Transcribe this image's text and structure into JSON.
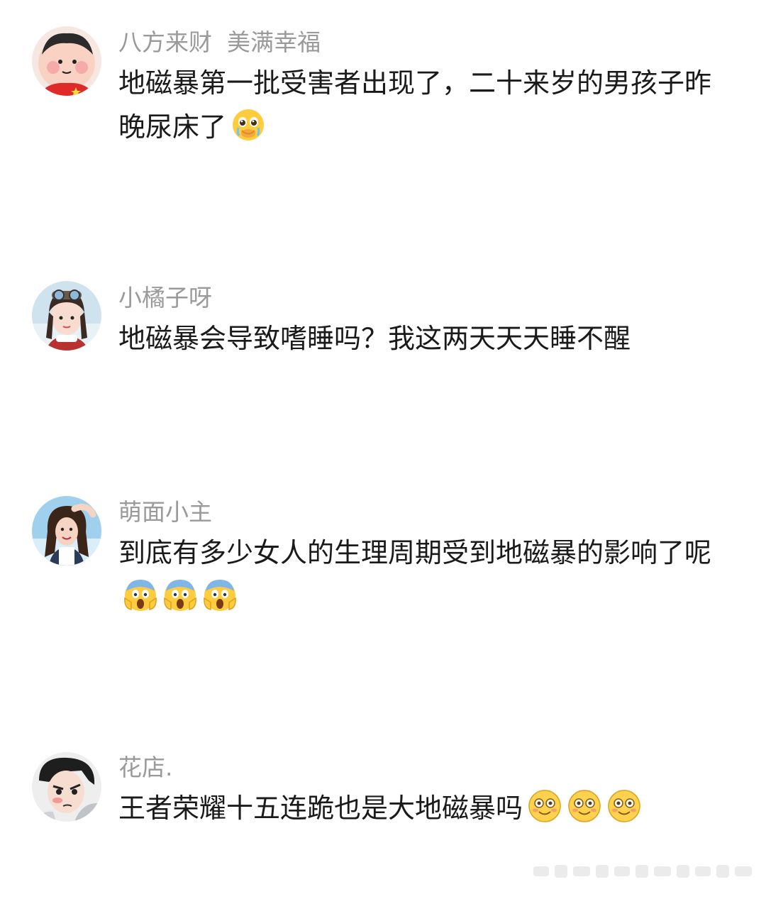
{
  "comments": [
    {
      "username": "八方来财  美满幸福",
      "text": "地磁暴第一批受害者出现了，二十来岁的男孩子昨晚尿床了",
      "emojis": [
        "pleading-face-icon"
      ],
      "avatar": "cartoon-boy-avatar"
    },
    {
      "username": "小橘子呀",
      "text": "地磁暴会导致嗜睡吗？我这两天天天睡不醒",
      "emojis": [],
      "avatar": "girl-goggles-avatar"
    },
    {
      "username": "萌面小主",
      "text": "到底有多少女人的生理周期受到地磁暴的影响了呢",
      "emojis": [
        "screaming-face-icon",
        "screaming-face-icon",
        "screaming-face-icon"
      ],
      "avatar": "girl-portrait-avatar"
    },
    {
      "username": "花店.",
      "text": "王者荣耀十五连跪也是大地磁暴吗",
      "emojis": [
        "flushed-smile-icon",
        "flushed-smile-icon",
        "flushed-smile-icon"
      ],
      "avatar": "anime-boy-avatar"
    }
  ],
  "colors": {
    "username": "#9a9a9a",
    "text": "#1a1a1a",
    "background": "#ffffff"
  }
}
